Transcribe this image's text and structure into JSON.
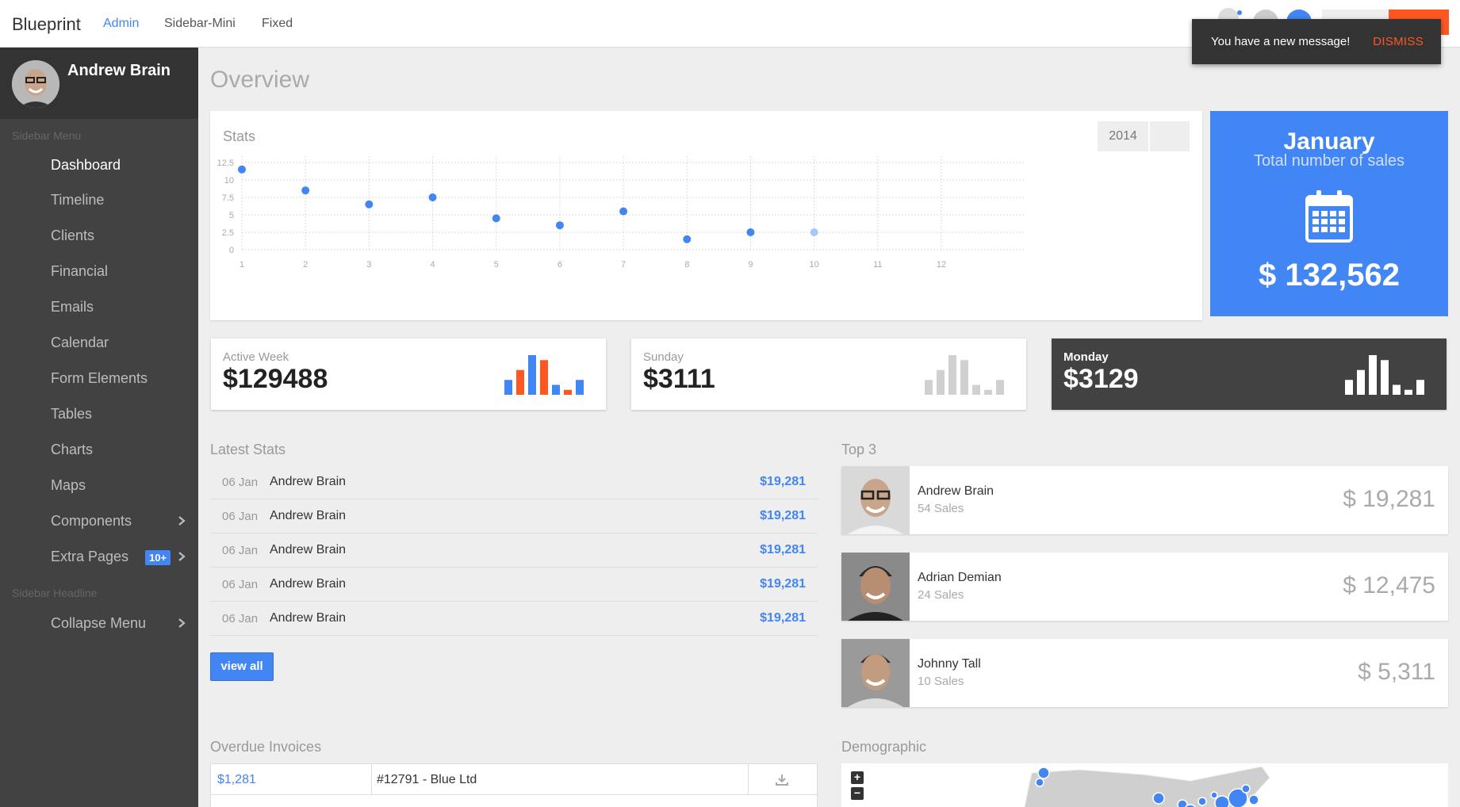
{
  "topbar": {
    "brand": "Blueprint",
    "nav": [
      "Admin",
      "Sidebar-Mini",
      "Fixed"
    ]
  },
  "toast": {
    "message": "You have a new message!",
    "action": "DISMISS"
  },
  "sidebar": {
    "user_name": "Andrew Brain",
    "menu_headline": "Sidebar Menu",
    "items": [
      {
        "label": "Dashboard"
      },
      {
        "label": "Timeline"
      },
      {
        "label": "Clients"
      },
      {
        "label": "Financial"
      },
      {
        "label": "Emails"
      },
      {
        "label": "Calendar"
      },
      {
        "label": "Form Elements"
      },
      {
        "label": "Tables"
      },
      {
        "label": "Charts"
      },
      {
        "label": "Maps"
      },
      {
        "label": "Components"
      },
      {
        "label": "Extra Pages",
        "badge": "10+"
      }
    ],
    "headline2": "Sidebar Headline",
    "collapse_label": "Collapse Menu"
  },
  "page": {
    "title": "Overview"
  },
  "stats": {
    "title": "Stats",
    "year": "2014"
  },
  "chart_data": {
    "type": "scatter",
    "title": "Stats",
    "x": [
      1,
      2,
      3,
      4,
      5,
      6,
      7,
      8,
      9,
      10
    ],
    "y": [
      11.5,
      8.5,
      6.5,
      7.5,
      4.5,
      3.5,
      5.5,
      1.5,
      2.5,
      2.5
    ],
    "x_ticks": [
      "1",
      "2",
      "3",
      "4",
      "5",
      "6",
      "7",
      "8",
      "9",
      "10",
      "11",
      "12"
    ],
    "y_ticks": [
      "0",
      "2.5",
      "5",
      "7.5",
      "10",
      "12.5"
    ],
    "xlim": [
      1,
      12
    ],
    "ylim": [
      0,
      12.5
    ],
    "grid": true,
    "color": "#4285f4",
    "last_point_color": "#a6c8fb"
  },
  "january": {
    "title": "January",
    "subtitle": "Total number of sales",
    "value": "$ 132,562",
    "icon": "calendar-icon"
  },
  "minis": [
    {
      "label": "Active Week",
      "value": "$129488",
      "bars": [
        3,
        5,
        8,
        7,
        2,
        1,
        3
      ],
      "colors": [
        "#4285f4",
        "#ff5722",
        "#4285f4",
        "#ff5722",
        "#4285f4",
        "#ff5722",
        "#4285f4"
      ]
    },
    {
      "label": "Sunday",
      "value": "$3111",
      "bars": [
        3,
        5,
        8,
        7,
        2,
        1,
        3
      ],
      "colors": [
        "#d0d0d0",
        "#d0d0d0",
        "#d0d0d0",
        "#d0d0d0",
        "#d0d0d0",
        "#d0d0d0",
        "#d0d0d0"
      ]
    },
    {
      "label": "Monday",
      "value": "$3129",
      "bars": [
        3,
        5,
        8,
        7,
        2,
        1,
        3
      ],
      "colors": [
        "#ffffff",
        "#ffffff",
        "#ffffff",
        "#ffffff",
        "#ffffff",
        "#ffffff",
        "#ffffff"
      ]
    }
  ],
  "latest": {
    "title": "Latest Stats",
    "rows": [
      {
        "date": "06 Jan",
        "name": "Andrew Brain",
        "amount": "$19,281"
      },
      {
        "date": "06 Jan",
        "name": "Andrew Brain",
        "amount": "$19,281"
      },
      {
        "date": "06 Jan",
        "name": "Andrew Brain",
        "amount": "$19,281"
      },
      {
        "date": "06 Jan",
        "name": "Andrew Brain",
        "amount": "$19,281"
      },
      {
        "date": "06 Jan",
        "name": "Andrew Brain",
        "amount": "$19,281"
      }
    ],
    "view_all": "view all"
  },
  "top3": {
    "title": "Top 3",
    "people": [
      {
        "name": "Andrew Brain",
        "sales": "54 Sales",
        "value": "$ 19,281"
      },
      {
        "name": "Adrian Demian",
        "sales": "24 Sales",
        "value": "$ 12,475"
      },
      {
        "name": "Johnny Tall",
        "sales": "10 Sales",
        "value": "$ 5,311"
      }
    ]
  },
  "invoices": {
    "title": "Overdue Invoices",
    "rows": [
      {
        "amount": "$1,281",
        "ref": "#12791 - Blue Ltd"
      }
    ]
  },
  "demographic": {
    "title": "Demographic",
    "zoom_in": "+",
    "zoom_out": "−"
  }
}
